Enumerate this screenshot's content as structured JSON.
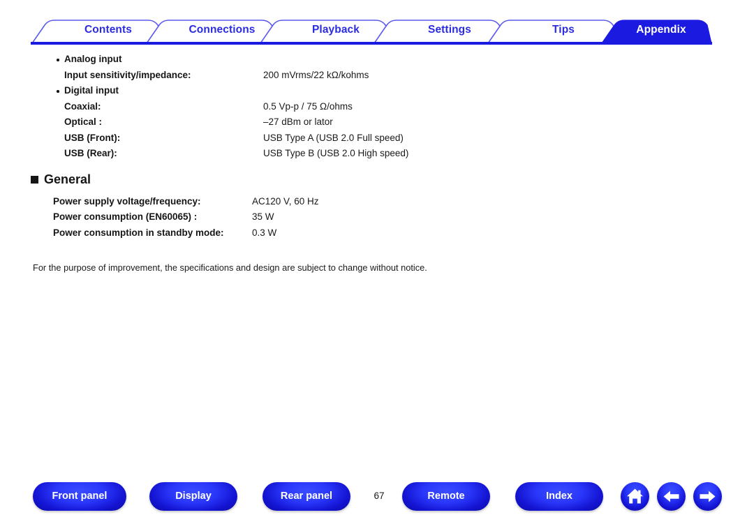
{
  "tabs": [
    {
      "label": "Contents",
      "active": false
    },
    {
      "label": "Connections",
      "active": false
    },
    {
      "label": "Playback",
      "active": false
    },
    {
      "label": "Settings",
      "active": false
    },
    {
      "label": "Tips",
      "active": false
    },
    {
      "label": "Appendix",
      "active": true
    }
  ],
  "content": {
    "groups": [
      {
        "bullet": "Analog input",
        "rows": [
          {
            "label": "Input sensitivity/impedance:",
            "value": "200 mVrms/22 kΩ/kohms"
          }
        ]
      },
      {
        "bullet": "Digital input",
        "rows": [
          {
            "label": "Coaxial:",
            "value": "0.5 Vp-p / 75 Ω/ohms"
          },
          {
            "label": "Optical :",
            "value": "–27 dBm or lator"
          },
          {
            "label": "USB (Front):",
            "value": "USB Type A (USB 2.0 Full speed)"
          },
          {
            "label": "USB (Rear):",
            "value": "USB Type B (USB 2.0 High speed)"
          }
        ]
      }
    ],
    "general": {
      "heading": "General",
      "rows": [
        {
          "label": "Power supply voltage/frequency:",
          "value": "AC120 V, 60 Hz"
        },
        {
          "label": "Power consumption (EN60065) :",
          "value": "35 W"
        },
        {
          "label": "Power consumption in standby mode:",
          "value": "0.3 W"
        }
      ]
    },
    "note": "For the purpose of improvement, the specifications and design are subject to change without notice."
  },
  "bottom_nav": {
    "buttons": [
      {
        "label": "Front panel"
      },
      {
        "label": "Display"
      },
      {
        "label": "Rear panel"
      },
      {
        "label": "Remote"
      },
      {
        "label": "Index"
      }
    ],
    "page_number": "67",
    "icons": [
      {
        "name": "home-icon"
      },
      {
        "name": "arrow-left-icon"
      },
      {
        "name": "arrow-right-icon"
      }
    ]
  },
  "colors": {
    "accent_blue": "#1a1ae0",
    "tab_text": "#2b2be0",
    "button_blue": "#2a37fa",
    "text": "#151515"
  }
}
